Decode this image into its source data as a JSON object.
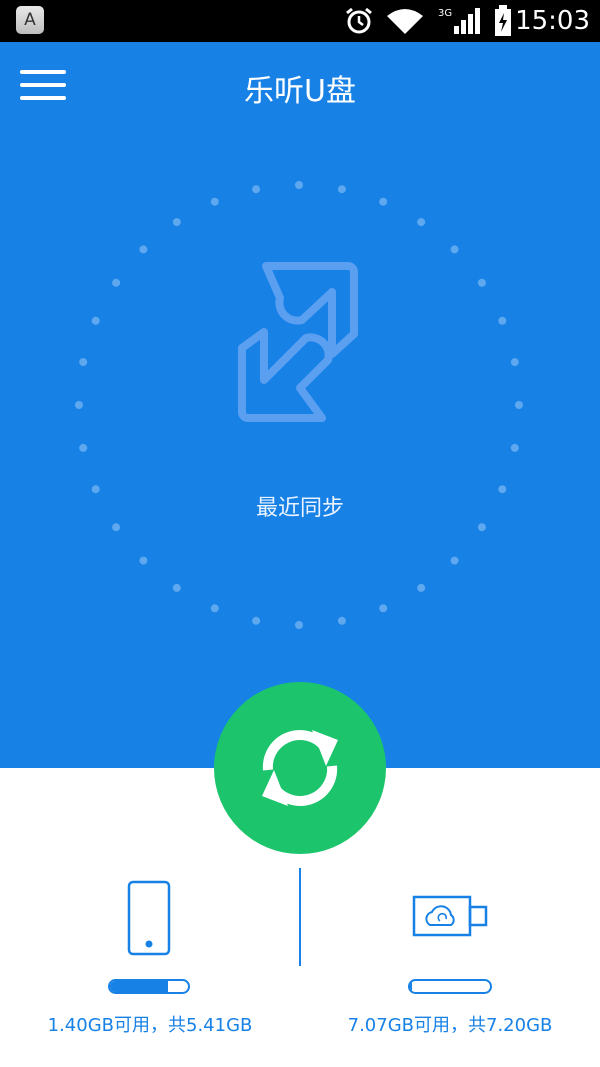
{
  "status_bar": {
    "keyboard_indicator": "A",
    "network": "3G",
    "time": "15:03",
    "icons": [
      "alarm-icon",
      "wifi-icon",
      "signal-icon",
      "battery-icon"
    ]
  },
  "header": {
    "title": "乐听U盘",
    "menu_icon": "hamburger-menu-icon"
  },
  "hero": {
    "recent_sync_label": "最近同步",
    "background_color": "#1781e6"
  },
  "sync_button": {
    "icon": "refresh-icon",
    "color": "#1cc46c"
  },
  "storage": {
    "phone": {
      "icon": "phone-icon",
      "text": "1.40GB可用，共5.41GB",
      "used_fraction": 0.74
    },
    "usb": {
      "icon": "usb-cloud-icon",
      "text": "7.07GB可用，共7.20GB",
      "used_fraction": 0.02
    }
  }
}
